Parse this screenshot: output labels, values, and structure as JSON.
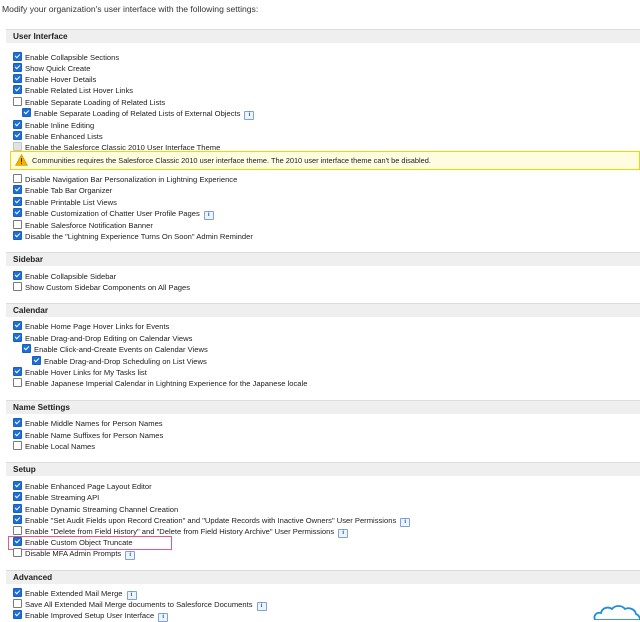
{
  "intro": "Modify your organization's user interface with the following settings:",
  "warning": "Communities requires the Salesforce Classic 2010 user interface theme. The 2010 user interface theme can't be disabled.",
  "sections": {
    "ui": {
      "title": "User Interface",
      "items": [
        {
          "label": "Enable Collapsible Sections",
          "checked": true
        },
        {
          "label": "Show Quick Create",
          "checked": true
        },
        {
          "label": "Enable Hover Details",
          "checked": true
        },
        {
          "label": "Enable Related List Hover Links",
          "checked": true
        },
        {
          "label": "Enable Separate Loading of Related Lists",
          "checked": false
        },
        {
          "label": "Enable Separate Loading of Related Lists of External Objects",
          "checked": true
        },
        {
          "label": "Enable Inline Editing",
          "checked": true
        },
        {
          "label": "Enable Enhanced Lists",
          "checked": true
        },
        {
          "label": "Enable the Salesforce Classic 2010 User Interface Theme",
          "checked": false
        },
        {
          "label": "Disable Navigation Bar Personalization in Lightning Experience",
          "checked": false
        },
        {
          "label": "Enable Tab Bar Organizer",
          "checked": true
        },
        {
          "label": "Enable Printable List Views",
          "checked": true
        },
        {
          "label": "Enable Customization of Chatter User Profile Pages",
          "checked": true
        },
        {
          "label": "Enable Salesforce Notification Banner",
          "checked": false
        },
        {
          "label": "Disable the \"Lightning Experience Turns On Soon\" Admin Reminder",
          "checked": true
        }
      ]
    },
    "sidebar": {
      "title": "Sidebar",
      "items": [
        {
          "label": "Enable Collapsible Sidebar",
          "checked": true
        },
        {
          "label": "Show Custom Sidebar Components on All Pages",
          "checked": false
        }
      ]
    },
    "calendar": {
      "title": "Calendar",
      "items": [
        {
          "label": "Enable Home Page Hover Links for Events",
          "checked": true
        },
        {
          "label": "Enable Drag-and-Drop Editing on Calendar Views",
          "checked": true
        },
        {
          "label": "Enable Click-and-Create Events on Calendar Views",
          "checked": true
        },
        {
          "label": "Enable Drag-and-Drop Scheduling on List Views",
          "checked": true
        },
        {
          "label": "Enable Hover Links for My Tasks list",
          "checked": true
        },
        {
          "label": "Enable Japanese Imperial Calendar in Lightning Experience for the Japanese locale",
          "checked": false
        }
      ]
    },
    "names": {
      "title": "Name Settings",
      "items": [
        {
          "label": "Enable Middle Names for Person Names",
          "checked": true
        },
        {
          "label": "Enable Name Suffixes for Person Names",
          "checked": true
        },
        {
          "label": "Enable Local Names",
          "checked": false
        }
      ]
    },
    "setup": {
      "title": "Setup",
      "items": [
        {
          "label": "Enable Enhanced Page Layout Editor",
          "checked": true
        },
        {
          "label": "Enable Streaming API",
          "checked": true
        },
        {
          "label": "Enable Dynamic Streaming Channel Creation",
          "checked": true
        },
        {
          "label": "Enable \"Set Audit Fields upon Record Creation\" and \"Update Records with Inactive Owners\" User Permissions",
          "checked": true
        },
        {
          "label": "Enable \"Delete from Field History\" and \"Delete from Field History Archive\" User Permissions",
          "checked": false
        },
        {
          "label": "Enable Custom Object Truncate",
          "checked": true
        },
        {
          "label": "Disable MFA Admin Prompts",
          "checked": false
        }
      ]
    },
    "advanced": {
      "title": "Advanced",
      "items": [
        {
          "label": "Enable Extended Mail Merge",
          "checked": true
        },
        {
          "label": "Save All Extended Mail Merge documents to Salesforce Documents",
          "checked": false
        },
        {
          "label": "Enable Improved Setup User Interface",
          "checked": true
        }
      ]
    }
  }
}
